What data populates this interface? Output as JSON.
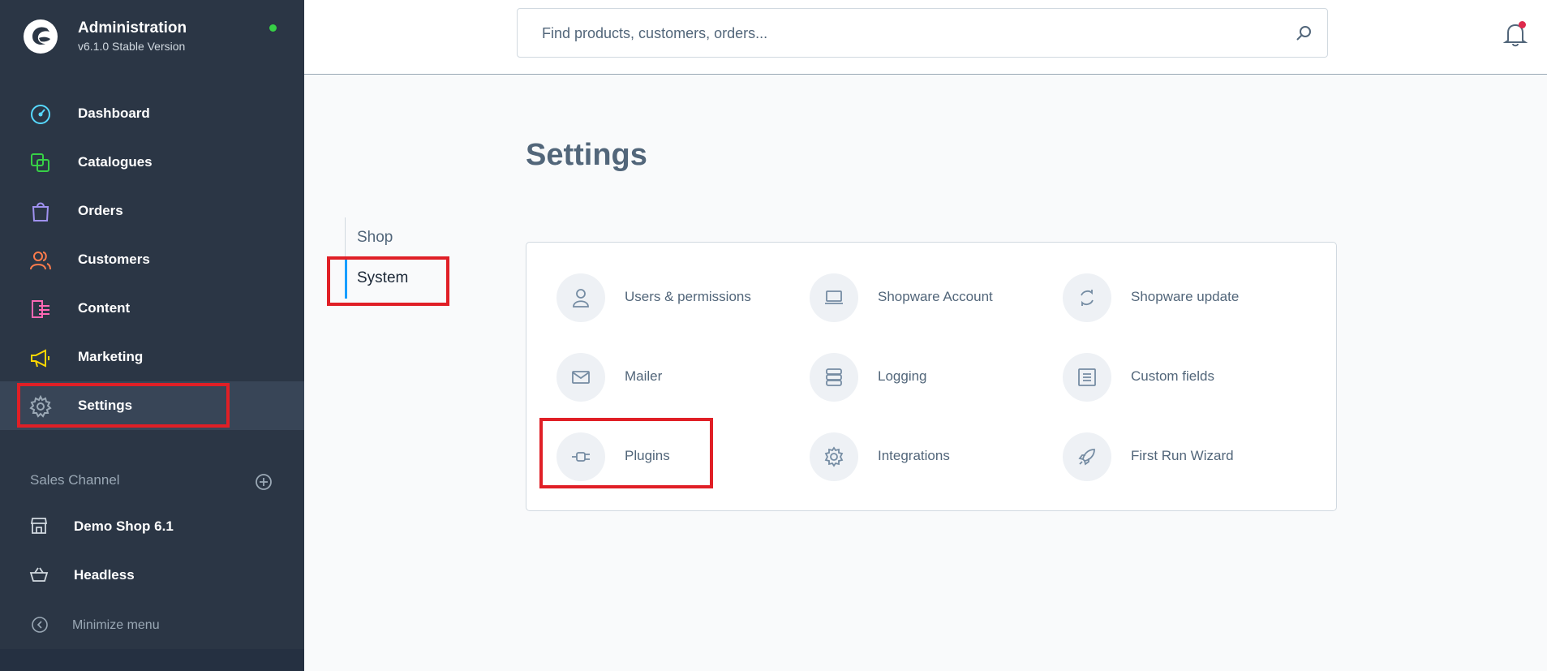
{
  "brand": {
    "title": "Administration",
    "version": "v6.1.0 Stable Version"
  },
  "nav": {
    "items": [
      {
        "label": "Dashboard",
        "icon": "dashboard-icon",
        "color": "#57d9ff"
      },
      {
        "label": "Catalogues",
        "icon": "catalogues-icon",
        "color": "#37d046"
      },
      {
        "label": "Orders",
        "icon": "orders-icon",
        "color": "#a092f0"
      },
      {
        "label": "Customers",
        "icon": "customers-icon",
        "color": "#ff7c4c"
      },
      {
        "label": "Content",
        "icon": "content-icon",
        "color": "#ff68b4"
      },
      {
        "label": "Marketing",
        "icon": "marketing-icon",
        "color": "#ffd700"
      },
      {
        "label": "Settings",
        "icon": "settings-icon",
        "color": "#9aa8b5"
      }
    ]
  },
  "sales_channel": {
    "header": "Sales Channel",
    "items": [
      {
        "label": "Demo Shop 6.1",
        "icon": "storefront-icon"
      },
      {
        "label": "Headless",
        "icon": "basket-icon"
      }
    ],
    "minimize_label": "Minimize menu"
  },
  "search": {
    "placeholder": "Find products, customers, orders..."
  },
  "page": {
    "title": "Settings"
  },
  "tabs": [
    {
      "label": "Shop"
    },
    {
      "label": "System"
    }
  ],
  "settings": [
    {
      "label": "Users & permissions",
      "icon": "user-icon"
    },
    {
      "label": "Shopware Account",
      "icon": "laptop-icon"
    },
    {
      "label": "Shopware update",
      "icon": "refresh-icon"
    },
    {
      "label": "Mailer",
      "icon": "envelope-icon"
    },
    {
      "label": "Logging",
      "icon": "server-icon"
    },
    {
      "label": "Custom fields",
      "icon": "list-icon"
    },
    {
      "label": "Plugins",
      "icon": "plug-icon"
    },
    {
      "label": "Integrations",
      "icon": "gear-icon"
    },
    {
      "label": "First Run Wizard",
      "icon": "rocket-icon"
    }
  ],
  "colors": {
    "sidebar_bg": "#2b3645",
    "accent": "#189eff",
    "highlight": "#e01f26",
    "online": "#37d046",
    "notification": "#de294c"
  }
}
